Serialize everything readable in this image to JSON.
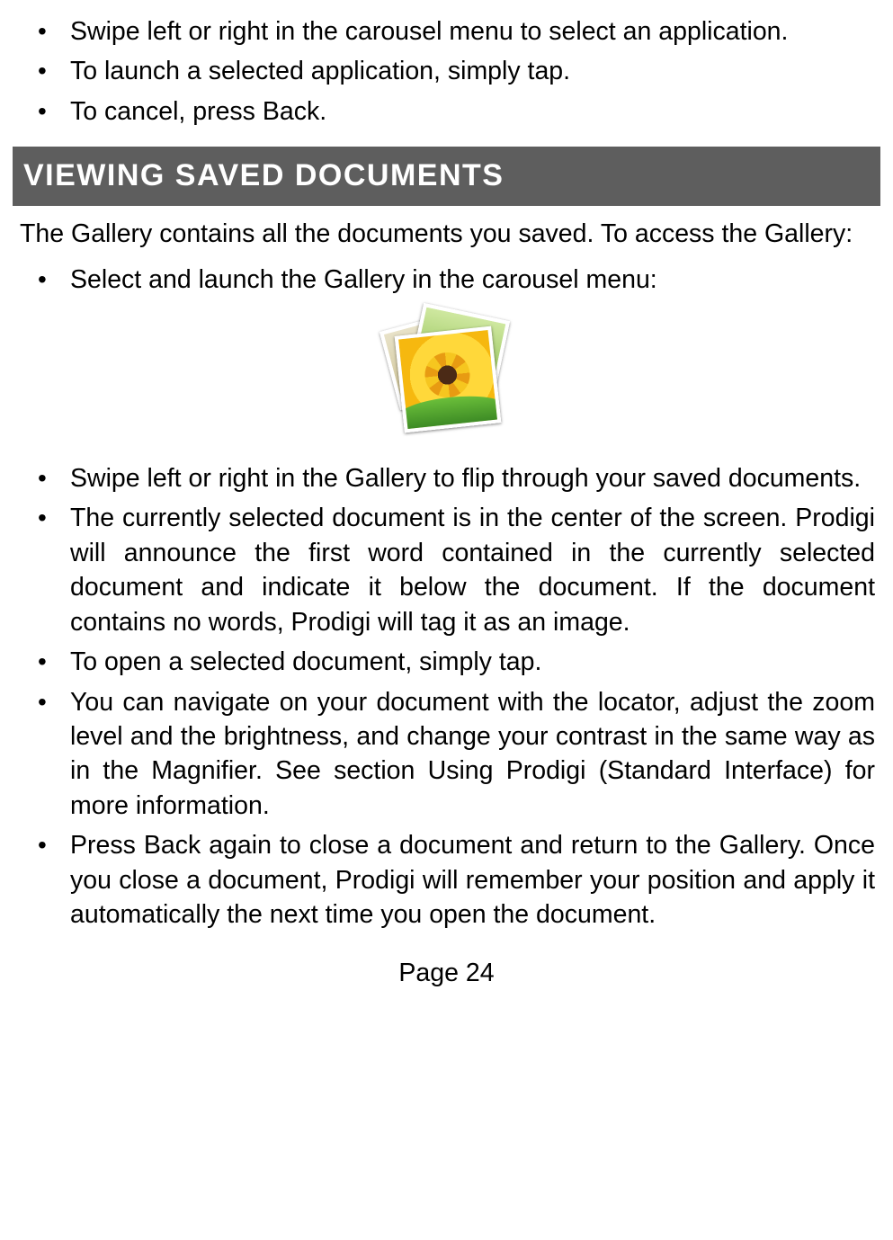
{
  "top_list": [
    "Swipe left or right in the carousel menu to select an application.",
    "To launch a selected application, simply tap.",
    "To cancel, press Back."
  ],
  "section_heading": "VIEWING SAVED DOCUMENTS",
  "intro_para": "The Gallery contains all the documents you saved. To access the Gallery:",
  "gallery_list_first": "Select and launch the Gallery in the carousel menu:",
  "gallery_list_rest": [
    "Swipe left or right in the Gallery to flip through your saved documents.",
    "The currently selected document is in the center of the screen. Prodigi will announce the first word contained in the currently selected document and indicate it below the document. If the document contains no words, Prodigi will tag it as an image.",
    "To open a selected document, simply tap.",
    "You can navigate on your document with the locator, adjust the zoom level and the brightness, and change your contrast in the same way as in the Magnifier. See section Using Prodigi (Standard Interface) for more information.",
    "Press Back again to close a document and return to the Gallery. Once you close a document, Prodigi will remember your position and apply it automatically the next time you open the document."
  ],
  "page_number": "Page 24"
}
